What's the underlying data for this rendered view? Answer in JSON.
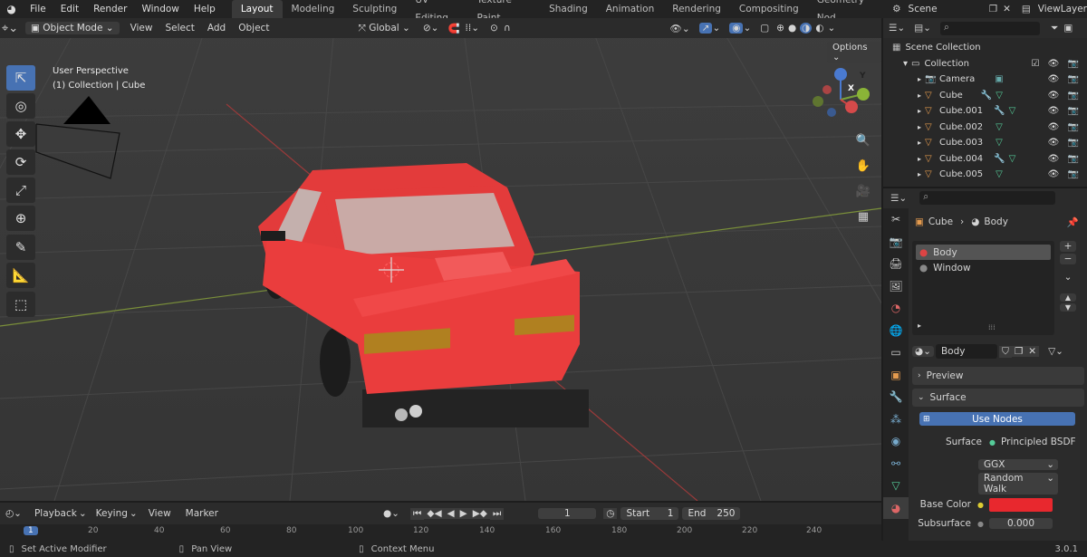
{
  "menu": [
    "File",
    "Edit",
    "Render",
    "Window",
    "Help"
  ],
  "workspaces": [
    "Layout",
    "Modeling",
    "Sculpting",
    "UV Editing",
    "Texture Paint",
    "Shading",
    "Animation",
    "Rendering",
    "Compositing",
    "Geometry Nod"
  ],
  "active_workspace": "Layout",
  "scene_name": "Scene",
  "view_layer": "ViewLayer",
  "viewport_header": {
    "mode": "Object Mode",
    "menus": [
      "View",
      "Select",
      "Add",
      "Object"
    ],
    "orientation": "Global",
    "options_label": "Options"
  },
  "viewport_info": {
    "perspective": "User Perspective",
    "context": "(1) Collection | Cube"
  },
  "gizmo": {
    "x": "X",
    "y": "Y",
    "z": "Z"
  },
  "outliner": {
    "root": "Scene Collection",
    "collection": "Collection",
    "items": [
      "Camera",
      "Cube",
      "Cube.001",
      "Cube.002",
      "Cube.003",
      "Cube.004",
      "Cube.005"
    ]
  },
  "properties": {
    "breadcrumb_object": "Cube",
    "breadcrumb_material": "Body",
    "slots": [
      "Body",
      "Window"
    ],
    "material_name": "Body",
    "panel_preview": "Preview",
    "panel_surface": "Surface",
    "use_nodes": "Use Nodes",
    "surface_label": "Surface",
    "surface_value": "Principled BSDF",
    "distribution": "GGX",
    "subsurface_method": "Random Walk",
    "base_color_label": "Base Color",
    "base_color": "#e8282e",
    "subsurface_label": "Subsurface",
    "subsurface_value": "0.000"
  },
  "timeline": {
    "menus": [
      "Playback",
      "Keying",
      "View",
      "Marker"
    ],
    "current_frame": "1",
    "start_label": "Start",
    "start": "1",
    "end_label": "End",
    "end": "250",
    "ruler": [
      "1",
      "20",
      "40",
      "60",
      "80",
      "100",
      "120",
      "140",
      "160",
      "180",
      "200",
      "220",
      "240"
    ]
  },
  "status": {
    "left": "Set Active Modifier",
    "middle": "Pan View",
    "right": "Context Menu",
    "version": "3.0.1"
  },
  "colors": {
    "accent": "#4772b3",
    "car": "#e53a3a"
  }
}
